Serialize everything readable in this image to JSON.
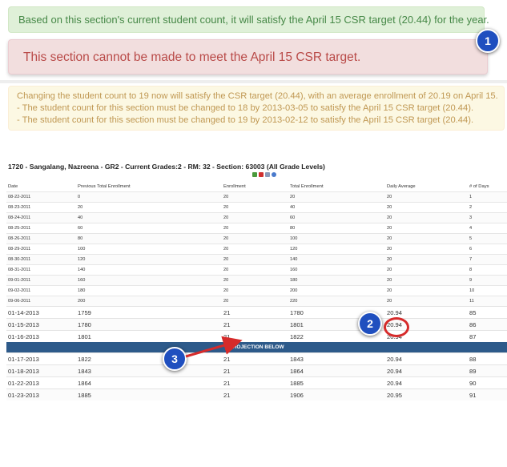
{
  "alerts": {
    "success": "Based on this section's current student count, it will satisfy the April 15 CSR target (20.44) for the year.",
    "danger": "This section cannot be made to meet the April 15 CSR target.",
    "warning": [
      "Changing the student count to 19 now will satisfy the CSR target (20.44), with an average enrollment of 20.19 on April 15.",
      "- The student count for this section must be changed to 18 by 2013-03-05 to satisfy the April 15 CSR target (20.44).",
      "- The student count for this section must be changed to 19 by 2013-02-12 to satisfy the April 15 CSR target (20.44)."
    ]
  },
  "section": {
    "title": "1720 - Sangalang, Nazreena - GR2 - Current Grades:2 - RM: 32 - Section: 63003 (All Grade Levels)"
  },
  "table": {
    "columns": [
      "Date",
      "Previous Total Enrollment",
      "Enrollment",
      "Total Enrollment",
      "Daily Average",
      "# of Days"
    ],
    "rows_small": [
      [
        "08-22-2011",
        "0",
        "20",
        "20",
        "20",
        "1"
      ],
      [
        "08-23-2011",
        "20",
        "20",
        "40",
        "20",
        "2"
      ],
      [
        "08-24-2011",
        "40",
        "20",
        "60",
        "20",
        "3"
      ],
      [
        "08-25-2011",
        "60",
        "20",
        "80",
        "20",
        "4"
      ],
      [
        "08-26-2011",
        "80",
        "20",
        "100",
        "20",
        "5"
      ],
      [
        "08-29-2011",
        "100",
        "20",
        "120",
        "20",
        "6"
      ],
      [
        "08-30-2011",
        "120",
        "20",
        "140",
        "20",
        "7"
      ],
      [
        "08-31-2011",
        "140",
        "20",
        "160",
        "20",
        "8"
      ],
      [
        "09-01-2011",
        "160",
        "20",
        "180",
        "20",
        "9"
      ],
      [
        "09-02-2011",
        "180",
        "20",
        "200",
        "20",
        "10"
      ],
      [
        "09-06-2011",
        "200",
        "20",
        "220",
        "20",
        "11"
      ]
    ],
    "rows_current": [
      [
        "01-14-2013",
        "1759",
        "21",
        "1780",
        "20.94",
        "85"
      ],
      [
        "01-15-2013",
        "1780",
        "21",
        "1801",
        "20.94",
        "86"
      ],
      [
        "01-16-2013",
        "1801",
        "21",
        "1822",
        "20.94",
        "87"
      ]
    ],
    "projection_label": "PROJECTION BELOW",
    "rows_projection": [
      [
        "01-17-2013",
        "1822",
        "21",
        "1843",
        "20.94",
        "88"
      ],
      [
        "01-18-2013",
        "1843",
        "21",
        "1864",
        "20.94",
        "89"
      ],
      [
        "01-22-2013",
        "1864",
        "21",
        "1885",
        "20.94",
        "90"
      ],
      [
        "01-23-2013",
        "1885",
        "21",
        "1906",
        "20.95",
        "91"
      ]
    ]
  },
  "callouts": [
    "1",
    "2",
    "3"
  ],
  "colors": {
    "success_bg": "#dff0d8",
    "danger_bg": "#f2dede",
    "warning_bg": "#fcf8e3",
    "projection_bar": "#2d5a8a",
    "callout": "#1f4fbf",
    "annotation_red": "#d62b2b"
  },
  "icons": [
    "table-icon",
    "pdf-icon",
    "print-icon",
    "info-icon"
  ]
}
